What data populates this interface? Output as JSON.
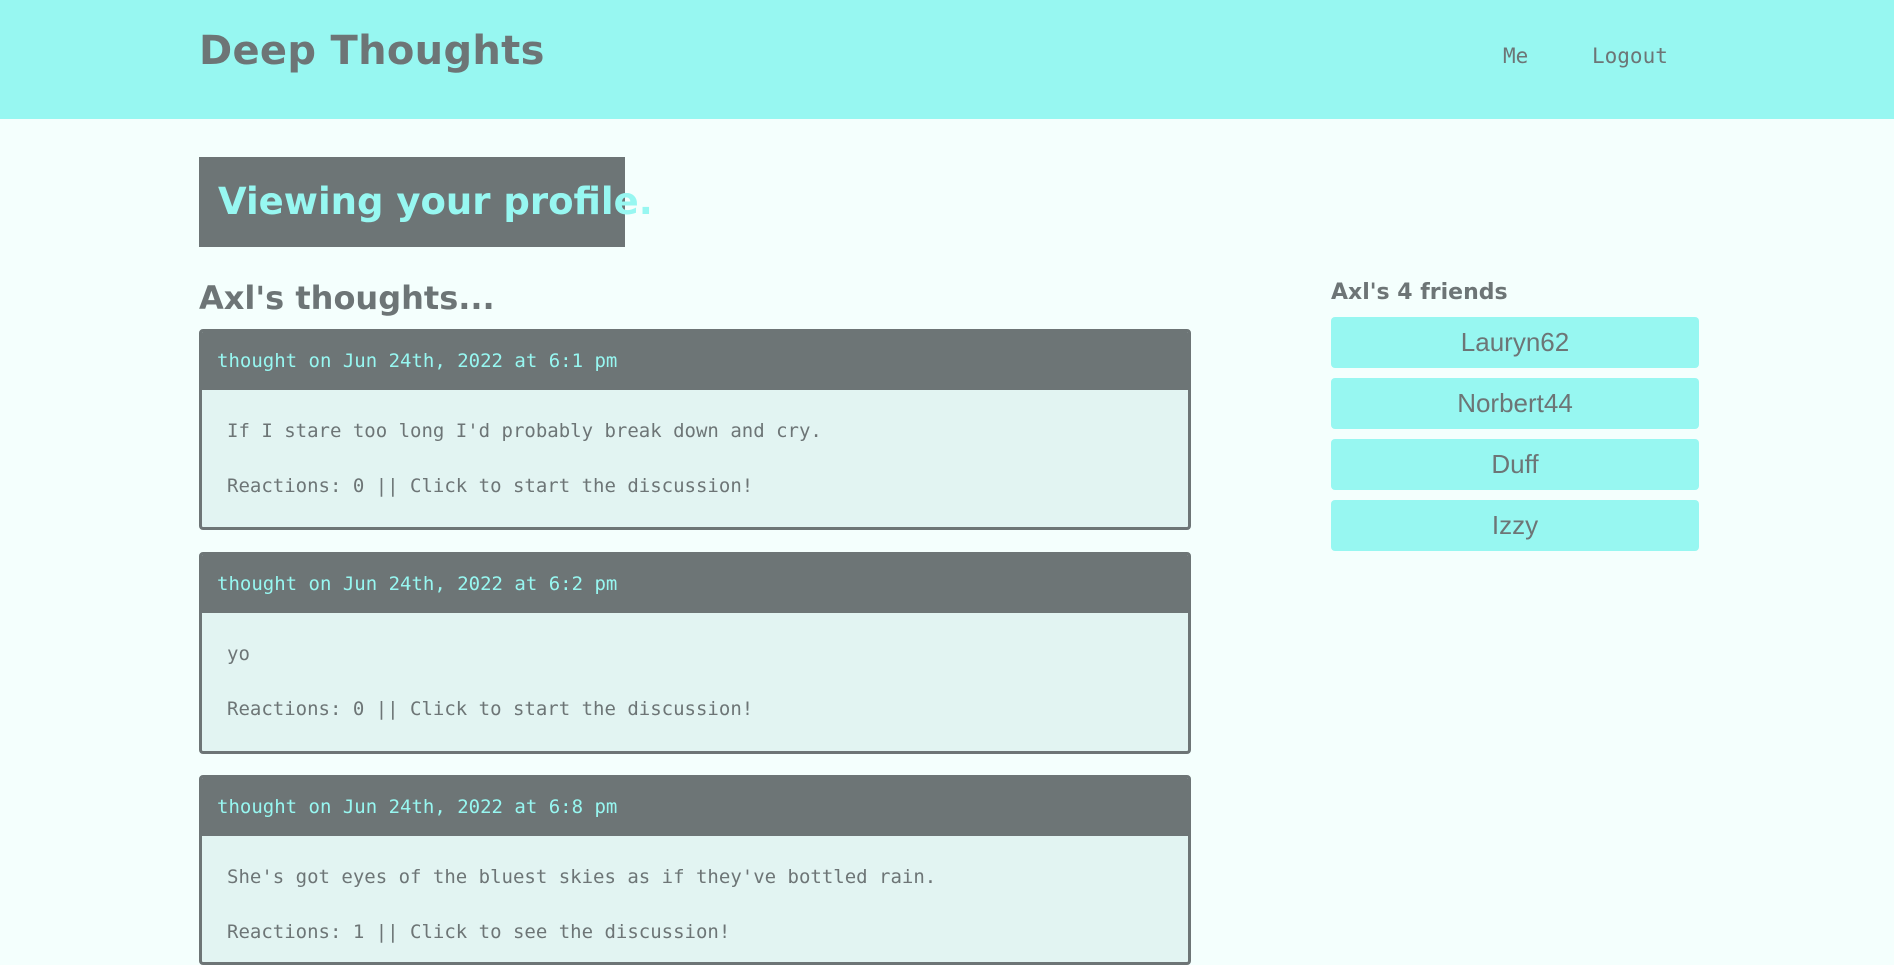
{
  "header": {
    "brand": "Deep Thoughts",
    "nav": {
      "me": "Me",
      "logout": "Logout"
    }
  },
  "profile": {
    "banner": "Viewing your profile.",
    "thoughts_heading": "Axl's thoughts...",
    "friends_heading": "Axl's 4 friends"
  },
  "thoughts": [
    {
      "header": "thought on Jun 24th, 2022 at 6:1 pm",
      "text": "If I stare too long I'd probably break down and cry.",
      "reactions": "Reactions: 0 || Click to start the discussion!"
    },
    {
      "header": "thought on Jun 24th, 2022 at 6:2 pm",
      "text": "yo",
      "reactions": "Reactions: 0 || Click to start the discussion!"
    },
    {
      "header": "thought on Jun 24th, 2022 at 6:8 pm",
      "text": "She's got eyes of the bluest skies as if they've bottled rain.",
      "reactions": "Reactions: 1 || Click to see the discussion!"
    }
  ],
  "friends": [
    "Lauryn62",
    "Norbert44",
    "Duff",
    "Izzy"
  ],
  "colors": {
    "accent": "#97f7f1",
    "dark": "#6d7576",
    "background": "#f4fffd",
    "card_body": "#e2f4f2"
  }
}
